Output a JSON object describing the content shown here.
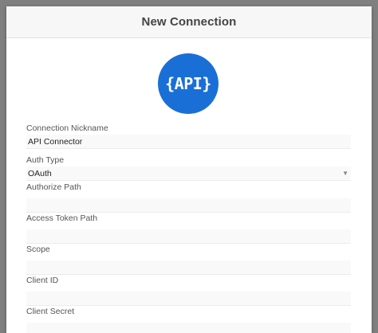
{
  "modal": {
    "title": "New Connection"
  },
  "logo": {
    "text": "{API}",
    "color": "#1a6fd6",
    "icon": "api-logo-icon"
  },
  "fields": [
    {
      "id": "nickname",
      "label": "Connection Nickname",
      "value": "API Connector"
    },
    {
      "id": "auth-type",
      "label": "Auth Type",
      "value": "OAuth",
      "type": "select"
    },
    {
      "id": "authorize-path",
      "label": "Authorize Path",
      "value": ""
    },
    {
      "id": "access-token-path",
      "label": "Access Token Path",
      "value": ""
    },
    {
      "id": "scope",
      "label": "Scope",
      "value": ""
    },
    {
      "id": "client-id",
      "label": "Client ID",
      "value": ""
    },
    {
      "id": "client-secret",
      "label": "Client Secret",
      "value": ""
    }
  ]
}
